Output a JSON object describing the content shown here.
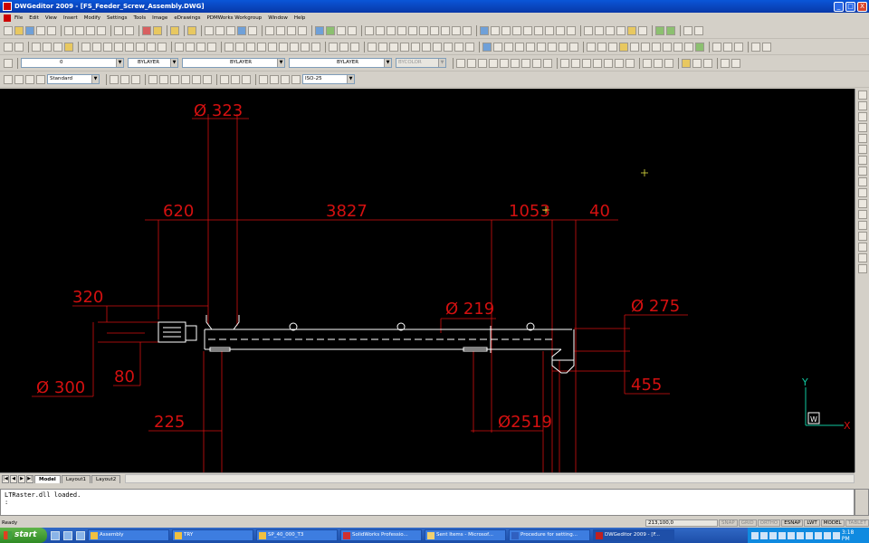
{
  "window": {
    "title": "DWGeditor 2009 - [FS_Feeder_Screw_Assembly.DWG]",
    "minimize": "_",
    "maximize": "□",
    "close": "X"
  },
  "menu": {
    "items": [
      "File",
      "Edit",
      "View",
      "Insert",
      "Modify",
      "Settings",
      "Tools",
      "Image",
      "eDrawings",
      "PDMWorks Workgroup",
      "Window",
      "Help"
    ]
  },
  "properties": {
    "layer": "0",
    "color": "BYLAYER",
    "linetype": "BYLAYER",
    "lineweight": "BYLAYER",
    "plotstyle": "BYCOLOR"
  },
  "styles": {
    "text_style": "Standard",
    "dim_style": "ISO-25"
  },
  "drawing": {
    "dimensions": {
      "d323": "Ø 323",
      "d620": "620",
      "d3827": "3827",
      "d1053": "1053",
      "d40": "40",
      "d320": "320",
      "d219": "Ø 219",
      "d275": "Ø 275",
      "d80": "80",
      "d300": "Ø 300",
      "d455": "455",
      "d225": "225",
      "d2519": "Ø2519"
    },
    "ucs": {
      "x": "X",
      "y": "Y",
      "w": "W"
    },
    "colors": {
      "dimension": "#d41010",
      "geometry": "#ffffff",
      "background": "#000000",
      "cursor": "#e0e040",
      "ucs": "#10c8a0"
    }
  },
  "layout_tabs": [
    "Model",
    "Layout1",
    "Layout2"
  ],
  "command_line": {
    "history": "LTRaster.dll loaded.",
    "prompt": ":"
  },
  "status": {
    "ready": "Ready",
    "coords": "213,100,0",
    "modes": [
      {
        "label": "SNAP",
        "on": false
      },
      {
        "label": "GRID",
        "on": false
      },
      {
        "label": "ORTHO",
        "on": false
      },
      {
        "label": "ESNAP",
        "on": true
      },
      {
        "label": "LWT",
        "on": true
      },
      {
        "label": "MODEL",
        "on": true
      },
      {
        "label": "TABLET",
        "on": false
      }
    ]
  },
  "taskbar": {
    "start": "start",
    "buttons": [
      "Assembly",
      "TRY",
      "SP_40_000_T3",
      "SolidWorks Professio...",
      "Sent Items - Microsof...",
      "Procedure for setting...",
      "DWGeditor 2009 - [F..."
    ],
    "active_index": 6,
    "clock": "3:18 PM"
  }
}
